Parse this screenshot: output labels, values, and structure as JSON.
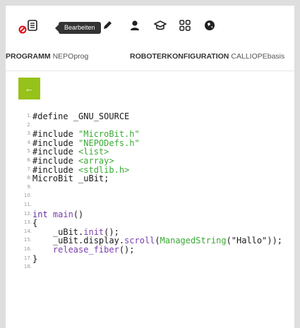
{
  "toolbar": {
    "tooltip": "Bearbeiten",
    "icons": [
      "disconnected-icon",
      "program-doc-icon",
      "edit-icon",
      "user-icon",
      "graduation-cap-icon",
      "gallery-icon",
      "globe-icon"
    ]
  },
  "tabs": {
    "program_label": "PROGRAMM",
    "program_value": "NEPOprog",
    "robot_label": "ROBOTERKONFIGURATION",
    "robot_value": "CALLIOPEbasis"
  },
  "back_button": "←",
  "code": {
    "line_numbers": [
      "1.",
      "2.",
      "3.",
      "4.",
      "5.",
      "6.",
      "7.",
      "8.",
      "9.",
      "10.",
      "11.",
      "12.",
      "13.",
      "14.",
      "15.",
      "16.",
      "17.",
      "18."
    ],
    "lines": [
      {
        "parts": [
          {
            "t": "#define _GNU_SOURCE",
            "c": ""
          }
        ]
      },
      {
        "parts": []
      },
      {
        "parts": [
          {
            "t": "#include ",
            "c": ""
          },
          {
            "t": "\"MicroBit.h\"",
            "c": "str"
          }
        ]
      },
      {
        "parts": [
          {
            "t": "#include ",
            "c": ""
          },
          {
            "t": "\"NEPODefs.h\"",
            "c": "str"
          }
        ]
      },
      {
        "parts": [
          {
            "t": "#include ",
            "c": ""
          },
          {
            "t": "<list>",
            "c": "str"
          }
        ]
      },
      {
        "parts": [
          {
            "t": "#include ",
            "c": ""
          },
          {
            "t": "<array>",
            "c": "str"
          }
        ]
      },
      {
        "parts": [
          {
            "t": "#include ",
            "c": ""
          },
          {
            "t": "<stdlib.h>",
            "c": "str"
          }
        ]
      },
      {
        "parts": [
          {
            "t": "MicroBit _uBit;",
            "c": ""
          }
        ]
      },
      {
        "parts": []
      },
      {
        "parts": []
      },
      {
        "parts": []
      },
      {
        "parts": [
          {
            "t": "int ",
            "c": "kw"
          },
          {
            "t": "main",
            "c": "fn"
          },
          {
            "t": "()",
            "c": ""
          }
        ]
      },
      {
        "parts": [
          {
            "t": "{",
            "c": ""
          }
        ]
      },
      {
        "parts": [
          {
            "t": "    _uBit.",
            "c": ""
          },
          {
            "t": "init",
            "c": "fn"
          },
          {
            "t": "();",
            "c": ""
          }
        ]
      },
      {
        "parts": [
          {
            "t": "    _uBit.display.",
            "c": ""
          },
          {
            "t": "scroll",
            "c": "fn"
          },
          {
            "t": "(",
            "c": ""
          },
          {
            "t": "ManagedString",
            "c": "str"
          },
          {
            "t": "(\"Hallo\"));",
            "c": ""
          }
        ]
      },
      {
        "parts": [
          {
            "t": "    ",
            "c": ""
          },
          {
            "t": "release_fiber",
            "c": "fn"
          },
          {
            "t": "();",
            "c": ""
          }
        ]
      },
      {
        "parts": [
          {
            "t": "}",
            "c": ""
          }
        ]
      },
      {
        "parts": []
      }
    ]
  },
  "colors": {
    "accent_green": "#97c21a",
    "error_red": "#e30613",
    "string_green": "#3aab35",
    "keyword_purple": "#6c2fa6"
  }
}
